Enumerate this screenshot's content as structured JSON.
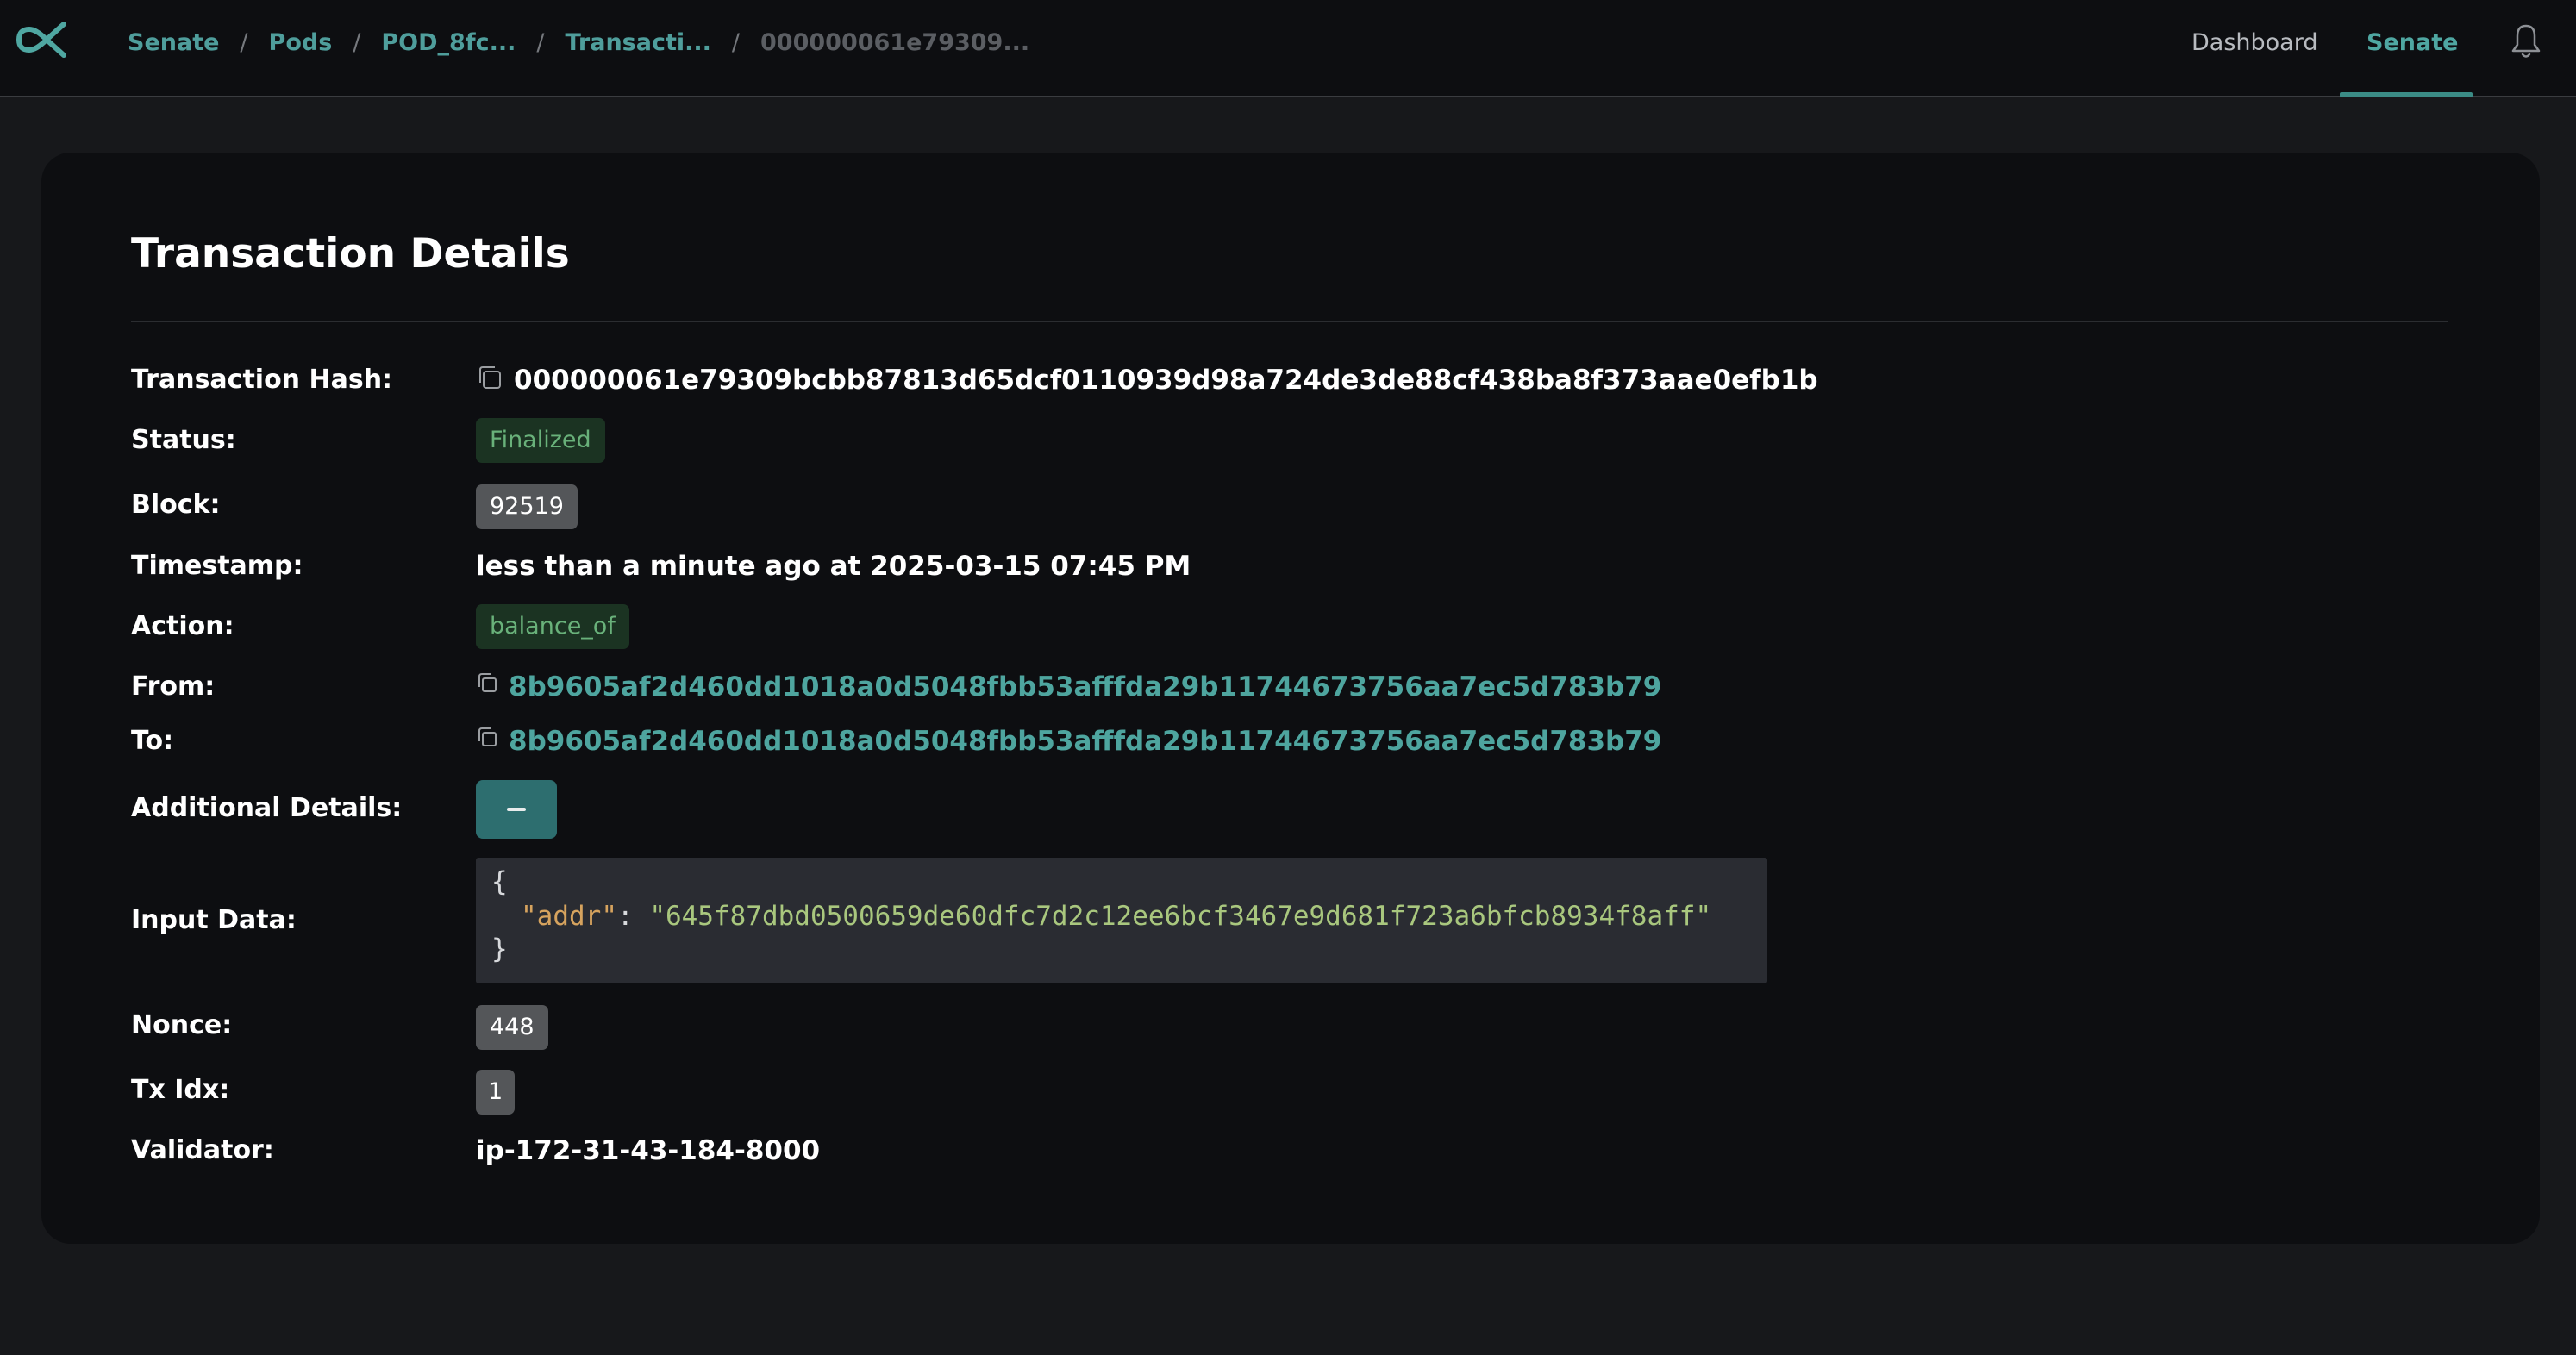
{
  "breadcrumb": [
    {
      "label": "Senate"
    },
    {
      "label": "Pods"
    },
    {
      "label": "POD_8fc..."
    },
    {
      "label": "Transacti..."
    },
    {
      "label": "000000061e79309..."
    }
  ],
  "nav": {
    "dashboard": "Dashboard",
    "senate": "Senate"
  },
  "icons": {
    "logo": "alpha-logo-icon",
    "bell": "bell-icon",
    "copy": "copy-icon",
    "collapse": "minus-icon"
  },
  "colors": {
    "accent": "#4fa7a2",
    "link": "#4ea59f",
    "badge_green_bg": "#1b3322",
    "badge_green_text": "#69b17a",
    "badge_gray_bg": "#545659",
    "button_bg": "#2d6e6f"
  },
  "page": {
    "title": "Transaction Details"
  },
  "labels": {
    "hash": "Transaction Hash:",
    "status": "Status:",
    "block": "Block:",
    "timestamp": "Timestamp:",
    "action": "Action:",
    "from": "From:",
    "to": "To:",
    "additional": "Additional Details:",
    "input": "Input Data:",
    "nonce": "Nonce:",
    "txidx": "Tx Idx:",
    "validator": "Validator:"
  },
  "tx": {
    "hash": "000000061e79309bcbb87813d65dcf0110939d98a724de3de88cf438ba8f373aae0efb1b",
    "status": "Finalized",
    "block": "92519",
    "timestamp": "less than a minute ago at 2025-03-15 07:45 PM",
    "action": "balance_of",
    "from": "8b9605af2d460dd1018a0d5048fbb53afffda29b11744673756aa7ec5d783b79",
    "to": "8b9605af2d460dd1018a0d5048fbb53afffda29b11744673756aa7ec5d783b79",
    "input_open": "{",
    "input_key": "\"addr\"",
    "input_colon": ": ",
    "input_value": "\"645f87dbd0500659de60dfc7d2c12ee6bcf3467e9d681f723a6bfcb8934f8aff\"",
    "input_close": "}",
    "nonce": "448",
    "tx_idx": "1",
    "validator": "ip-172-31-43-184-8000"
  }
}
